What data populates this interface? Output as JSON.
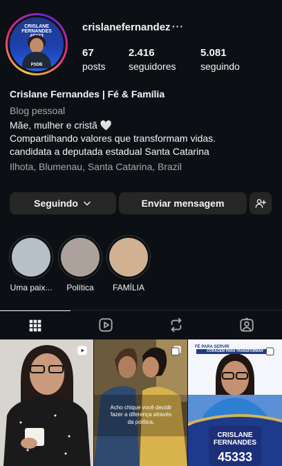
{
  "profile": {
    "username": "crislanefernandez",
    "more_icon": "more-horizontal-icon",
    "avatar": {
      "campaign_line1": "CRISLANE",
      "campaign_line2": "FERNANDES",
      "campaign_number": "45333",
      "party": "PSDB"
    }
  },
  "stats": [
    {
      "value": "67",
      "label": "posts"
    },
    {
      "value": "2.416",
      "label": "seguidores"
    },
    {
      "value": "5.081",
      "label": "seguindo"
    }
  ],
  "bio": {
    "name": "Crislane Fernandes | Fé & Família",
    "category": "Blog pessoal",
    "lines": [
      "Mãe, mulher e cristã 🤍",
      "Compartilhando valores que transformam vidas.",
      "candidata a deputada estadual Santa Catarina"
    ],
    "location": "Ilhota, Blumenau, Santa Catarina, Brazil"
  },
  "buttons": {
    "following": "Seguindo",
    "message": "Enviar mensagem",
    "add_user_icon": "add-user-icon"
  },
  "highlights": [
    {
      "label": "Uma paix...",
      "color": "#b7c0c9"
    },
    {
      "label": "Política",
      "color": "#ada29b"
    },
    {
      "label": "FAMÍLIA",
      "color": "#d2b193"
    }
  ],
  "tabs": [
    {
      "icon": "grid-icon",
      "active": true
    },
    {
      "icon": "reels-icon",
      "active": false
    },
    {
      "icon": "reposts-icon",
      "active": false
    },
    {
      "icon": "tagged-icon",
      "active": false
    }
  ],
  "posts": [
    {
      "type": "reel",
      "caption": ""
    },
    {
      "type": "carousel",
      "caption": "Acho chique você decidir fazer a diferença através da política."
    },
    {
      "type": "carousel",
      "top_text": "FÉ PARA SERVIR",
      "banner": "CORAGEM PARA TRANSFORMAR",
      "name_line1": "CRISLANE",
      "name_line2": "FERNANDES",
      "number": "45333"
    }
  ],
  "colors": {
    "background": "#0c1014",
    "button": "#262626",
    "secondary_text": "#a8a8a8"
  }
}
